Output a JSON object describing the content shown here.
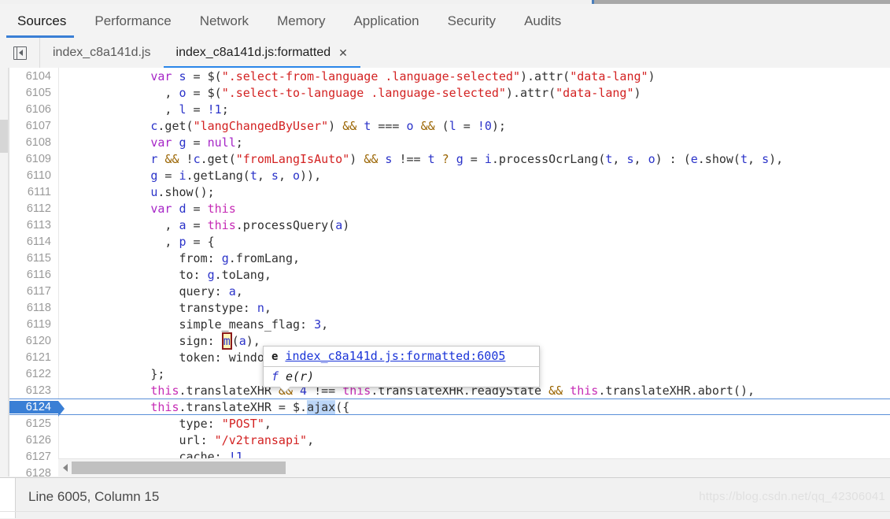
{
  "window": {
    "accent_color": "#3a7fd5",
    "watermark": "https://blog.csdn.net/qq_42306041"
  },
  "panel_tabs": [
    {
      "label": "Sources",
      "active": true
    },
    {
      "label": "Performance",
      "active": false
    },
    {
      "label": "Network",
      "active": false
    },
    {
      "label": "Memory",
      "active": false
    },
    {
      "label": "Application",
      "active": false
    },
    {
      "label": "Security",
      "active": false
    },
    {
      "label": "Audits",
      "active": false
    }
  ],
  "file_tabs": {
    "navigator_toggle": "show-navigator",
    "tabs": [
      {
        "label": "index_c8a141d.js",
        "active": false,
        "closable": false
      },
      {
        "label": "index_c8a141d.js:formatted",
        "active": true,
        "closable": true,
        "close_label": "✕"
      }
    ]
  },
  "editor": {
    "first_line_number": 6104,
    "current_line_number": 6124,
    "selection_text": "ajax",
    "highlighted_token": "m",
    "lines": [
      {
        "n": "6104",
        "tokens": [
          {
            "t": "            ",
            "c": "plain"
          },
          {
            "t": "var",
            "c": "kw"
          },
          {
            "t": " ",
            "c": "plain"
          },
          {
            "t": "s",
            "c": "var"
          },
          {
            "t": " = ",
            "c": "plain"
          },
          {
            "t": "$(",
            "c": "plain"
          },
          {
            "t": "\".select-from-language .language-selected\"",
            "c": "str"
          },
          {
            "t": ").attr(",
            "c": "plain"
          },
          {
            "t": "\"data-lang\"",
            "c": "str"
          },
          {
            "t": ")",
            "c": "plain"
          }
        ]
      },
      {
        "n": "6105",
        "tokens": [
          {
            "t": "              , ",
            "c": "plain"
          },
          {
            "t": "o",
            "c": "var"
          },
          {
            "t": " = ",
            "c": "plain"
          },
          {
            "t": "$(",
            "c": "plain"
          },
          {
            "t": "\".select-to-language .language-selected\"",
            "c": "str"
          },
          {
            "t": ").attr(",
            "c": "plain"
          },
          {
            "t": "\"data-lang\"",
            "c": "str"
          },
          {
            "t": ")",
            "c": "plain"
          }
        ]
      },
      {
        "n": "6106",
        "tokens": [
          {
            "t": "              , ",
            "c": "plain"
          },
          {
            "t": "l",
            "c": "var"
          },
          {
            "t": " = ",
            "c": "plain"
          },
          {
            "t": "!1",
            "c": "num"
          },
          {
            "t": ";",
            "c": "plain"
          }
        ]
      },
      {
        "n": "6107",
        "tokens": [
          {
            "t": "            ",
            "c": "plain"
          },
          {
            "t": "c",
            "c": "var"
          },
          {
            "t": ".get(",
            "c": "plain"
          },
          {
            "t": "\"langChangedByUser\"",
            "c": "str"
          },
          {
            "t": ") ",
            "c": "plain"
          },
          {
            "t": "&&",
            "c": "op"
          },
          {
            "t": " ",
            "c": "plain"
          },
          {
            "t": "t",
            "c": "var"
          },
          {
            "t": " === ",
            "c": "plain"
          },
          {
            "t": "o",
            "c": "var"
          },
          {
            "t": " ",
            "c": "plain"
          },
          {
            "t": "&&",
            "c": "op"
          },
          {
            "t": " (",
            "c": "plain"
          },
          {
            "t": "l",
            "c": "var"
          },
          {
            "t": " = ",
            "c": "plain"
          },
          {
            "t": "!0",
            "c": "num"
          },
          {
            "t": ");",
            "c": "plain"
          }
        ]
      },
      {
        "n": "6108",
        "tokens": [
          {
            "t": "            ",
            "c": "plain"
          },
          {
            "t": "var",
            "c": "kw"
          },
          {
            "t": " ",
            "c": "plain"
          },
          {
            "t": "g",
            "c": "var"
          },
          {
            "t": " = ",
            "c": "plain"
          },
          {
            "t": "null",
            "c": "kw"
          },
          {
            "t": ";",
            "c": "plain"
          }
        ]
      },
      {
        "n": "6109",
        "tokens": [
          {
            "t": "            ",
            "c": "plain"
          },
          {
            "t": "r",
            "c": "var"
          },
          {
            "t": " ",
            "c": "plain"
          },
          {
            "t": "&&",
            "c": "op"
          },
          {
            "t": " !",
            "c": "plain"
          },
          {
            "t": "c",
            "c": "var"
          },
          {
            "t": ".get(",
            "c": "plain"
          },
          {
            "t": "\"fromLangIsAuto\"",
            "c": "str"
          },
          {
            "t": ") ",
            "c": "plain"
          },
          {
            "t": "&&",
            "c": "op"
          },
          {
            "t": " ",
            "c": "plain"
          },
          {
            "t": "s",
            "c": "var"
          },
          {
            "t": " !== ",
            "c": "plain"
          },
          {
            "t": "t",
            "c": "var"
          },
          {
            "t": " ",
            "c": "plain"
          },
          {
            "t": "?",
            "c": "op"
          },
          {
            "t": " ",
            "c": "plain"
          },
          {
            "t": "g",
            "c": "var"
          },
          {
            "t": " = ",
            "c": "plain"
          },
          {
            "t": "i",
            "c": "var"
          },
          {
            "t": ".processOcrLang(",
            "c": "plain"
          },
          {
            "t": "t",
            "c": "var"
          },
          {
            "t": ", ",
            "c": "plain"
          },
          {
            "t": "s",
            "c": "var"
          },
          {
            "t": ", ",
            "c": "plain"
          },
          {
            "t": "o",
            "c": "var"
          },
          {
            "t": ") : (",
            "c": "plain"
          },
          {
            "t": "e",
            "c": "var"
          },
          {
            "t": ".show(",
            "c": "plain"
          },
          {
            "t": "t",
            "c": "var"
          },
          {
            "t": ", ",
            "c": "plain"
          },
          {
            "t": "s",
            "c": "var"
          },
          {
            "t": "),",
            "c": "plain"
          }
        ]
      },
      {
        "n": "6110",
        "tokens": [
          {
            "t": "            ",
            "c": "plain"
          },
          {
            "t": "g",
            "c": "var"
          },
          {
            "t": " = ",
            "c": "plain"
          },
          {
            "t": "i",
            "c": "var"
          },
          {
            "t": ".getLang(",
            "c": "plain"
          },
          {
            "t": "t",
            "c": "var"
          },
          {
            "t": ", ",
            "c": "plain"
          },
          {
            "t": "s",
            "c": "var"
          },
          {
            "t": ", ",
            "c": "plain"
          },
          {
            "t": "o",
            "c": "var"
          },
          {
            "t": ")),",
            "c": "plain"
          }
        ]
      },
      {
        "n": "6111",
        "tokens": [
          {
            "t": "            ",
            "c": "plain"
          },
          {
            "t": "u",
            "c": "var"
          },
          {
            "t": ".show();",
            "c": "plain"
          }
        ]
      },
      {
        "n": "6112",
        "tokens": [
          {
            "t": "            ",
            "c": "plain"
          },
          {
            "t": "var",
            "c": "kw"
          },
          {
            "t": " ",
            "c": "plain"
          },
          {
            "t": "d",
            "c": "var"
          },
          {
            "t": " = ",
            "c": "plain"
          },
          {
            "t": "this",
            "c": "this"
          }
        ]
      },
      {
        "n": "6113",
        "tokens": [
          {
            "t": "              , ",
            "c": "plain"
          },
          {
            "t": "a",
            "c": "var"
          },
          {
            "t": " = ",
            "c": "plain"
          },
          {
            "t": "this",
            "c": "this"
          },
          {
            "t": ".processQuery(",
            "c": "plain"
          },
          {
            "t": "a",
            "c": "var"
          },
          {
            "t": ")",
            "c": "plain"
          }
        ]
      },
      {
        "n": "6114",
        "tokens": [
          {
            "t": "              , ",
            "c": "plain"
          },
          {
            "t": "p",
            "c": "var"
          },
          {
            "t": " = {",
            "c": "plain"
          }
        ]
      },
      {
        "n": "6115",
        "tokens": [
          {
            "t": "                from: ",
            "c": "plain"
          },
          {
            "t": "g",
            "c": "var"
          },
          {
            "t": ".fromLang,",
            "c": "plain"
          }
        ]
      },
      {
        "n": "6116",
        "tokens": [
          {
            "t": "                to: ",
            "c": "plain"
          },
          {
            "t": "g",
            "c": "var"
          },
          {
            "t": ".toLang,",
            "c": "plain"
          }
        ]
      },
      {
        "n": "6117",
        "tokens": [
          {
            "t": "                query: ",
            "c": "plain"
          },
          {
            "t": "a",
            "c": "var"
          },
          {
            "t": ",",
            "c": "plain"
          }
        ]
      },
      {
        "n": "6118",
        "tokens": [
          {
            "t": "                transtype: ",
            "c": "plain"
          },
          {
            "t": "n",
            "c": "var"
          },
          {
            "t": ",",
            "c": "plain"
          }
        ]
      },
      {
        "n": "6119",
        "tokens": [
          {
            "t": "                simple_means_flag: ",
            "c": "plain"
          },
          {
            "t": "3",
            "c": "num"
          },
          {
            "t": ",",
            "c": "plain"
          }
        ]
      },
      {
        "n": "6120",
        "tokens": [
          {
            "t": "                sign: ",
            "c": "plain"
          },
          {
            "t": "m",
            "c": "hl"
          },
          {
            "t": "(",
            "c": "plain"
          },
          {
            "t": "a",
            "c": "var"
          },
          {
            "t": "),",
            "c": "plain"
          }
        ]
      },
      {
        "n": "6121",
        "tokens": [
          {
            "t": "                token: window.common.token",
            "c": "plain"
          }
        ]
      },
      {
        "n": "6122",
        "tokens": [
          {
            "t": "            };",
            "c": "plain"
          }
        ]
      },
      {
        "n": "6123",
        "tokens": [
          {
            "t": "            ",
            "c": "plain"
          },
          {
            "t": "this",
            "c": "this"
          },
          {
            "t": ".translateXHR ",
            "c": "plain"
          },
          {
            "t": "&&",
            "c": "op"
          },
          {
            "t": " ",
            "c": "plain"
          },
          {
            "t": "4",
            "c": "num"
          },
          {
            "t": " !== ",
            "c": "plain"
          },
          {
            "t": "this",
            "c": "this"
          },
          {
            "t": ".translateXHR.readyState ",
            "c": "plain"
          },
          {
            "t": "&&",
            "c": "op"
          },
          {
            "t": " ",
            "c": "plain"
          },
          {
            "t": "this",
            "c": "this"
          },
          {
            "t": ".translateXHR.abort(),",
            "c": "plain"
          }
        ]
      },
      {
        "n": "6124",
        "current": true,
        "tokens": [
          {
            "t": "            ",
            "c": "plain"
          },
          {
            "t": "this",
            "c": "this"
          },
          {
            "t": ".translateXHR = $.",
            "c": "plain"
          },
          {
            "t": "ajax",
            "c": "sel"
          },
          {
            "t": "({",
            "c": "plain"
          }
        ]
      },
      {
        "n": "6125",
        "tokens": [
          {
            "t": "                type: ",
            "c": "plain"
          },
          {
            "t": "\"POST\"",
            "c": "str"
          },
          {
            "t": ",",
            "c": "plain"
          }
        ]
      },
      {
        "n": "6126",
        "tokens": [
          {
            "t": "                url: ",
            "c": "plain"
          },
          {
            "t": "\"/v2transapi\"",
            "c": "str"
          },
          {
            "t": ",",
            "c": "plain"
          }
        ]
      },
      {
        "n": "6127",
        "tokens": [
          {
            "t": "                cache: ",
            "c": "plain"
          },
          {
            "t": "!1",
            "c": "num"
          },
          {
            "t": ",",
            "c": "plain"
          }
        ]
      },
      {
        "n": "6128",
        "tokens": [
          {
            "t": "",
            "c": "plain"
          }
        ]
      }
    ]
  },
  "popup": {
    "key": "e",
    "link": "index_c8a141d.js:formatted:6005",
    "fn_key": "f",
    "fn_value": "e(r)"
  },
  "statusbar": {
    "position_text": "Line 6005, Column 15"
  }
}
